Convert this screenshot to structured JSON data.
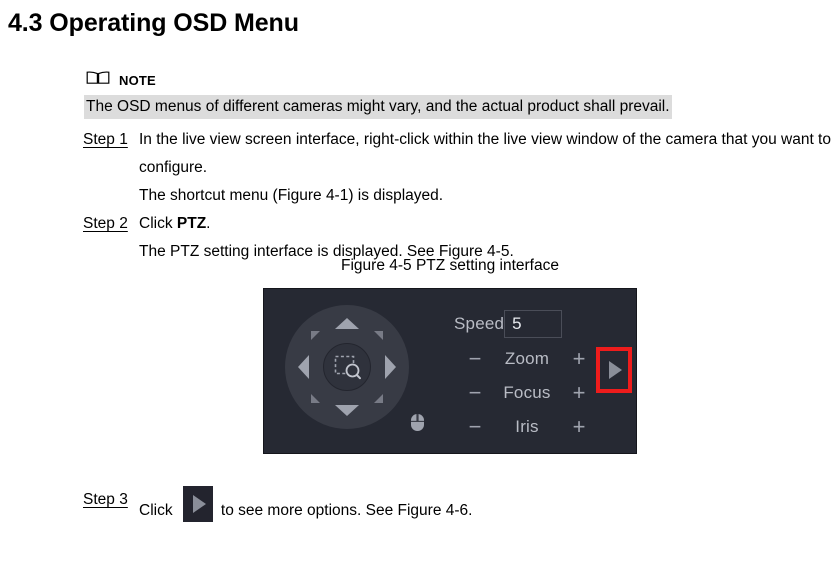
{
  "document": {
    "heading": "4.3 Operating OSD Menu",
    "note": {
      "icon": "book-icon",
      "label": "NOTE",
      "text": "The OSD menus of different cameras might vary, and the actual product shall prevail."
    },
    "steps": [
      {
        "key": "Step 1",
        "text": "In the live view screen interface, right-click within the live view window of the camera that you want to configure."
      },
      {
        "key": "",
        "text": "The shortcut menu (Figure 4-1) is displayed."
      },
      {
        "key": "Step 2",
        "text_before": "Click ",
        "bold": "PTZ",
        "text_after": "."
      },
      {
        "key": "",
        "text": "The PTZ setting interface is displayed. See Figure 4-5."
      }
    ],
    "figure": {
      "caption": "Figure 4-5 PTZ setting interface"
    },
    "step3": {
      "key": "Step 3",
      "text_before": "Click ",
      "icon": "play-arrow-icon",
      "text_after": "to see more options. See Figure 4-6."
    }
  },
  "ptz_panel": {
    "background_color": "#262933",
    "dpad": {
      "up": "▲",
      "down": "▼",
      "left": "◀",
      "right": "▶",
      "upper_left": "diagonal-up-left",
      "upper_right": "diagonal-up-right",
      "lower_left": "diagonal-down-left",
      "lower_right": "diagonal-down-right",
      "center_icon": "zoom-area-icon"
    },
    "speed": {
      "label": "Speed",
      "value": "5"
    },
    "controls": [
      {
        "minus": "−",
        "name": "Zoom",
        "plus": "+"
      },
      {
        "minus": "−",
        "name": "Focus",
        "plus": "+"
      },
      {
        "minus": "−",
        "name": "Iris",
        "plus": "+"
      }
    ],
    "mouse_icon": "mouse-icon",
    "more_options_button": "play-arrow-icon",
    "annotation_color": "#ee1c1c"
  }
}
